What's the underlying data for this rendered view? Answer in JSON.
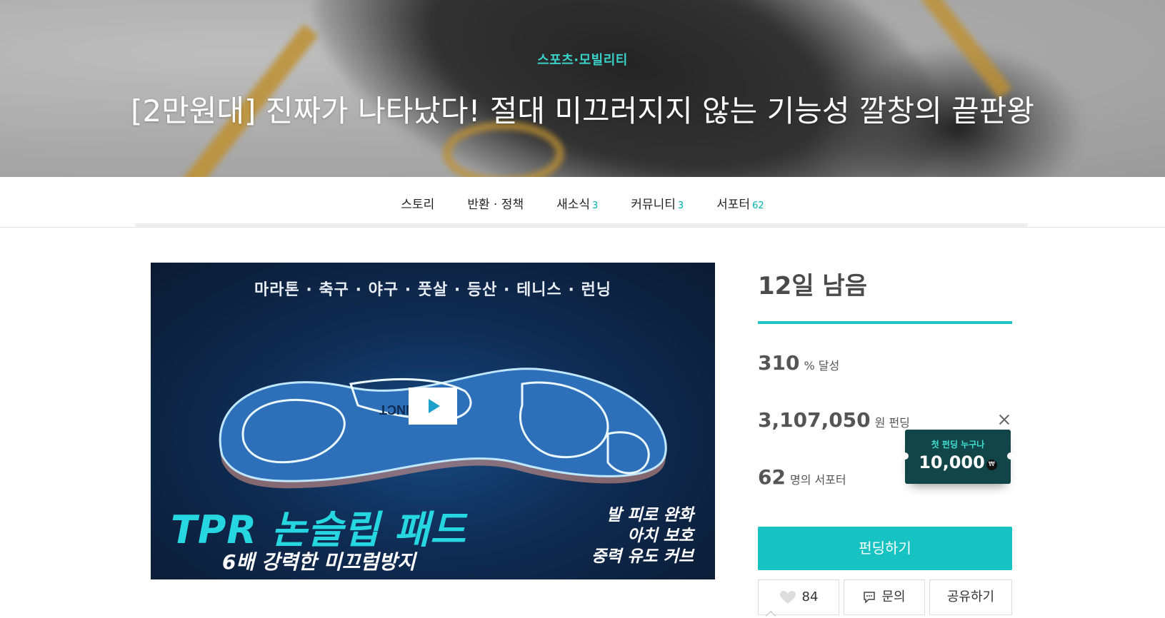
{
  "hero": {
    "category": "스포츠·모빌리티",
    "title": "[2만원대] 진짜가 나타났다! 절대 미끄러지지 않는 기능성 깔창의 끝판왕"
  },
  "tabs": [
    {
      "label": "스토리",
      "count": ""
    },
    {
      "label": "반환 · 정책",
      "count": ""
    },
    {
      "label": "새소식",
      "count": "3"
    },
    {
      "label": "커뮤니티",
      "count": "3"
    },
    {
      "label": "서포터",
      "count": "62"
    }
  ],
  "video": {
    "sports": "마라톤 · 축구 · 야구 · 풋살 · 등산 · 테니스 · 런닝",
    "headline": "TPR 논슬립 패드",
    "subline": "6배 강력한 미끄럼방지",
    "features": [
      "발 피로 완화",
      "아치 보호",
      "중력 유도 커브"
    ],
    "insole_text": "INNCT"
  },
  "campaign": {
    "days_left": "12일 남음",
    "achieved": {
      "value": "310",
      "unit": "% 달성"
    },
    "funded": {
      "value": "3,107,050",
      "unit": "원 펀딩"
    },
    "supporters": {
      "value": "62",
      "unit": "명의 서포터"
    },
    "progress_fraction": 1.0
  },
  "coupon": {
    "label": "첫 펀딩 누구나",
    "amount": "10,000",
    "currency_badge": "₩"
  },
  "actions": {
    "fund_label": "펀딩하기",
    "like_count": "84",
    "inquiry_label": "문의",
    "share_label": "공유하기"
  },
  "colors": {
    "accent": "#17c2c2",
    "category": "#3ad1c9",
    "coupon_bg": "#124548"
  }
}
